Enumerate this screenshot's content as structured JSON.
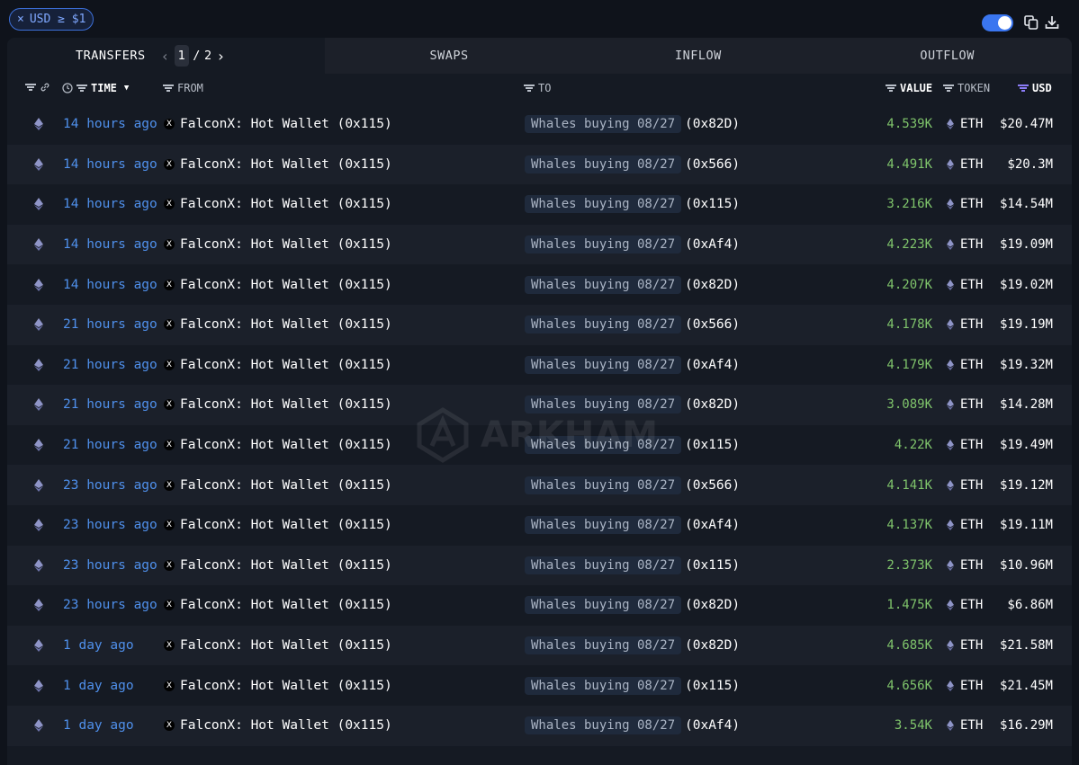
{
  "filter_chip": {
    "close": "×",
    "label": "USD ≥ $1"
  },
  "tabs": [
    {
      "label": "TRANSFERS"
    },
    {
      "label": "SWAPS"
    },
    {
      "label": "INFLOW"
    },
    {
      "label": "OUTFLOW"
    }
  ],
  "pager": {
    "current": "1",
    "separator": "/",
    "total": "2"
  },
  "columns": {
    "time": "TIME",
    "from": "FROM",
    "to": "TO",
    "value": "VALUE",
    "token": "TOKEN",
    "usd": "USD"
  },
  "watermark": "ARKHAM",
  "rows": [
    {
      "time": "14 hours ago",
      "from": "FalconX: Hot Wallet (0x115)",
      "to_label": "Whales buying 08/27",
      "to_addr": "(0x82D)",
      "value": "4.539K",
      "token": "ETH",
      "usd": "$20.47M"
    },
    {
      "time": "14 hours ago",
      "from": "FalconX: Hot Wallet (0x115)",
      "to_label": "Whales buying 08/27",
      "to_addr": "(0x566)",
      "value": "4.491K",
      "token": "ETH",
      "usd": "$20.3M"
    },
    {
      "time": "14 hours ago",
      "from": "FalconX: Hot Wallet (0x115)",
      "to_label": "Whales buying 08/27",
      "to_addr": "(0x115)",
      "value": "3.216K",
      "token": "ETH",
      "usd": "$14.54M"
    },
    {
      "time": "14 hours ago",
      "from": "FalconX: Hot Wallet (0x115)",
      "to_label": "Whales buying 08/27",
      "to_addr": "(0xAf4)",
      "value": "4.223K",
      "token": "ETH",
      "usd": "$19.09M"
    },
    {
      "time": "14 hours ago",
      "from": "FalconX: Hot Wallet (0x115)",
      "to_label": "Whales buying 08/27",
      "to_addr": "(0x82D)",
      "value": "4.207K",
      "token": "ETH",
      "usd": "$19.02M"
    },
    {
      "time": "21 hours ago",
      "from": "FalconX: Hot Wallet (0x115)",
      "to_label": "Whales buying 08/27",
      "to_addr": "(0x566)",
      "value": "4.178K",
      "token": "ETH",
      "usd": "$19.19M"
    },
    {
      "time": "21 hours ago",
      "from": "FalconX: Hot Wallet (0x115)",
      "to_label": "Whales buying 08/27",
      "to_addr": "(0xAf4)",
      "value": "4.179K",
      "token": "ETH",
      "usd": "$19.32M"
    },
    {
      "time": "21 hours ago",
      "from": "FalconX: Hot Wallet (0x115)",
      "to_label": "Whales buying 08/27",
      "to_addr": "(0x82D)",
      "value": "3.089K",
      "token": "ETH",
      "usd": "$14.28M"
    },
    {
      "time": "21 hours ago",
      "from": "FalconX: Hot Wallet (0x115)",
      "to_label": "Whales buying 08/27",
      "to_addr": "(0x115)",
      "value": "4.22K",
      "token": "ETH",
      "usd": "$19.49M"
    },
    {
      "time": "23 hours ago",
      "from": "FalconX: Hot Wallet (0x115)",
      "to_label": "Whales buying 08/27",
      "to_addr": "(0x566)",
      "value": "4.141K",
      "token": "ETH",
      "usd": "$19.12M"
    },
    {
      "time": "23 hours ago",
      "from": "FalconX: Hot Wallet (0x115)",
      "to_label": "Whales buying 08/27",
      "to_addr": "(0xAf4)",
      "value": "4.137K",
      "token": "ETH",
      "usd": "$19.11M"
    },
    {
      "time": "23 hours ago",
      "from": "FalconX: Hot Wallet (0x115)",
      "to_label": "Whales buying 08/27",
      "to_addr": "(0x115)",
      "value": "2.373K",
      "token": "ETH",
      "usd": "$10.96M"
    },
    {
      "time": "23 hours ago",
      "from": "FalconX: Hot Wallet (0x115)",
      "to_label": "Whales buying 08/27",
      "to_addr": "(0x82D)",
      "value": "1.475K",
      "token": "ETH",
      "usd": "$6.86M"
    },
    {
      "time": "1 day ago",
      "from": "FalconX: Hot Wallet (0x115)",
      "to_label": "Whales buying 08/27",
      "to_addr": "(0x82D)",
      "value": "4.685K",
      "token": "ETH",
      "usd": "$21.58M"
    },
    {
      "time": "1 day ago",
      "from": "FalconX: Hot Wallet (0x115)",
      "to_label": "Whales buying 08/27",
      "to_addr": "(0x115)",
      "value": "4.656K",
      "token": "ETH",
      "usd": "$21.45M"
    },
    {
      "time": "1 day ago",
      "from": "FalconX: Hot Wallet (0x115)",
      "to_label": "Whales buying 08/27",
      "to_addr": "(0xAf4)",
      "value": "3.54K",
      "token": "ETH",
      "usd": "$16.29M"
    }
  ],
  "icons": {
    "filter": "filter-icon",
    "link": "link-icon",
    "clock": "clock-icon",
    "eth": "ethereum-icon",
    "falconx": "falconx-logo-icon",
    "copy": "copy-icon",
    "download": "download-icon"
  },
  "colors": {
    "background": "#0f131b",
    "panel": "#151a23",
    "time_link": "#4f90ec",
    "value_green": "#7fc46b",
    "accent_blue": "#3a76f0",
    "accent_purple": "#8b7cf6"
  }
}
